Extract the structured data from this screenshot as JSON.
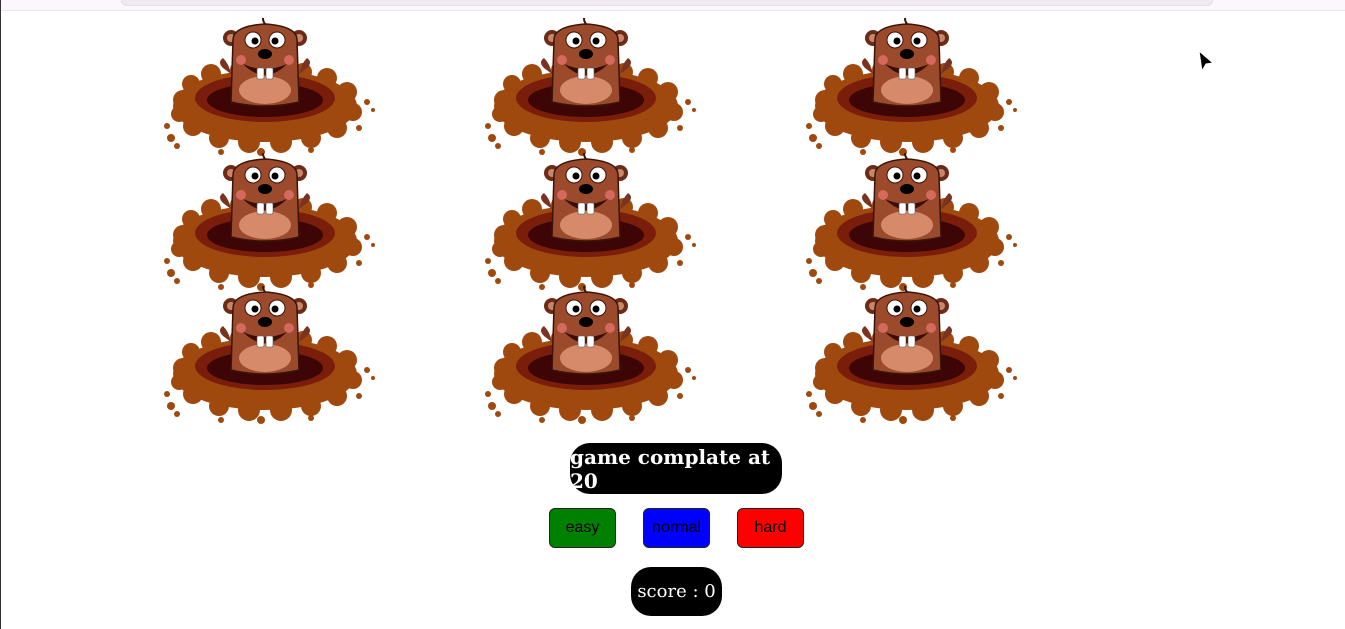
{
  "game": {
    "status_text": "game complate at 20",
    "score_text": "score : 0",
    "difficulty_buttons": [
      {
        "label": "easy",
        "color": "#008000"
      },
      {
        "label": "normal",
        "color": "#0000ff"
      },
      {
        "label": "hard",
        "color": "#ff0000"
      }
    ],
    "holes": [
      {
        "mole": "mole-icon"
      },
      {
        "mole": "mole-icon"
      },
      {
        "mole": "mole-icon"
      },
      {
        "mole": "mole-icon"
      },
      {
        "mole": "mole-icon"
      },
      {
        "mole": "mole-icon"
      },
      {
        "mole": "mole-icon"
      },
      {
        "mole": "mole-icon"
      },
      {
        "mole": "mole-icon"
      }
    ]
  },
  "colors": {
    "dirt": "#a0490f",
    "hole_dark": "#3d0505",
    "mole_body": "#9b4a2c",
    "pill_bg": "#000000",
    "pill_text": "#ffffff"
  }
}
